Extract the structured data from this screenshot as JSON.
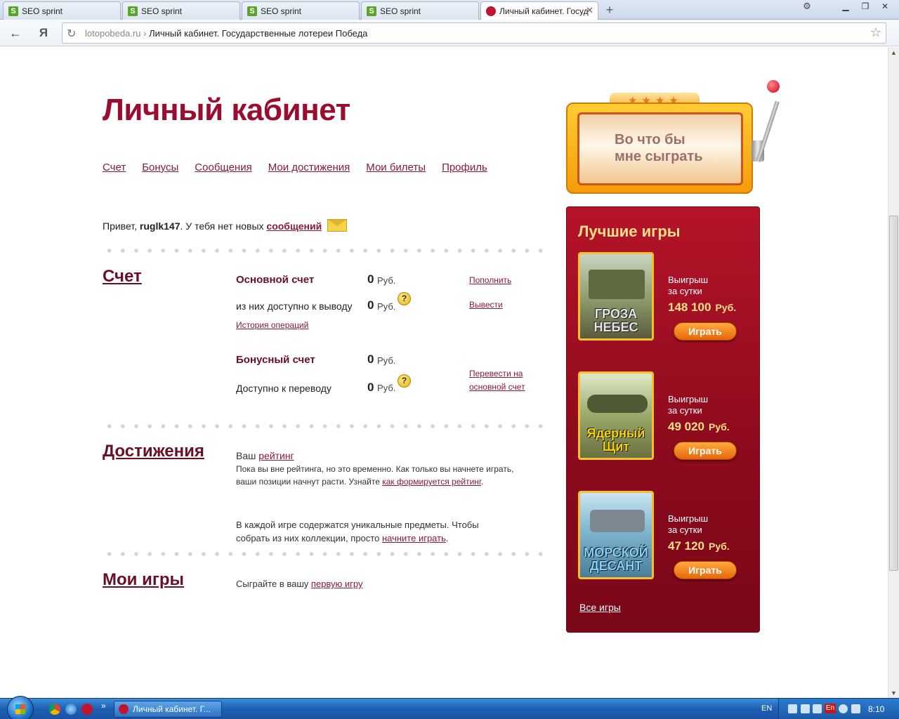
{
  "browser": {
    "tabs": [
      {
        "label": "SEO sprint",
        "active": false
      },
      {
        "label": "SEO sprint",
        "active": false
      },
      {
        "label": "SEO sprint",
        "active": false
      },
      {
        "label": "SEO sprint",
        "active": false
      },
      {
        "label": "Личный кабинет. Госуд",
        "active": true
      }
    ],
    "back_icon": "back-arrow-icon",
    "yandex_button": "Я",
    "address": {
      "domain": "lotopobeda.ru",
      "separator": "›",
      "page_title": "Личный кабинет. Государственные лотереи Победа"
    }
  },
  "page": {
    "title": "Личный кабинет",
    "nav": [
      "Счет",
      "Бонусы",
      "Сообщения",
      "Мои достижения",
      "Мои билеты",
      "Профиль"
    ],
    "greeting": {
      "prefix": "Привет,",
      "username": "ruglk147",
      "middle": ". У тебя нет новых",
      "link": "сообщений"
    },
    "account": {
      "title": "Счет",
      "main_label": "Основной счет",
      "main_value": "0",
      "currency": "Руб.",
      "topup_link": "Пополнить",
      "withdrawable_label": "из них доступно к выводу",
      "withdrawable_value": "0",
      "withdraw_link": "Вывести",
      "history_link": "История операций",
      "bonus_label": "Бонусный счет",
      "bonus_value": "0",
      "transferable_label": "Доступно к переводу",
      "transferable_value": "0",
      "transfer_link_1": "Перевести на",
      "transfer_link_2": "основной счет",
      "help_glyph": "?"
    },
    "achievements": {
      "title": "Достижения",
      "rating_prefix": "Ваш",
      "rating_link": "рейтинг",
      "text_1": "Пока вы вне рейтинга, но это временно. Как только вы начнете играть,",
      "text_2": "ваши позиции начнут расти. Узнайте",
      "rating_how_link": "как формируется рейтинг",
      "text_3": "В каждой игре содержатся уникальные предметы. Чтобы",
      "text_4": "собрать из них коллекции, просто",
      "start_link": "начните играть"
    },
    "my_games": {
      "title": "Мои игры",
      "prefix": "Сыграйте в вашу",
      "link": "первую игру"
    }
  },
  "banner": {
    "line1": "Во что бы",
    "line2": "мне сыграть",
    "stars": "★★★★"
  },
  "best_games": {
    "title": "Лучшие игры",
    "win_label_1": "Выигрыш",
    "win_label_2": "за сутки",
    "currency": "Руб.",
    "play_label": "Играть",
    "all_games": "Все игры",
    "games": [
      {
        "name_1": "ГРОЗА",
        "name_2": "НЕБЕС",
        "amount": "148 100"
      },
      {
        "name_1": "Ядерный",
        "name_2": "Щит",
        "amount": "49 020"
      },
      {
        "name_1": "МОРСКОЙ",
        "name_2": "ДЕСАНТ",
        "amount": "47 120"
      }
    ]
  },
  "taskbar": {
    "task_label": "Личный кабинет. Г...",
    "lang": "EN",
    "tray_lang": "En",
    "clock": "8:10",
    "more": "»"
  },
  "colors": {
    "brand": "#9b0d2e",
    "link": "#8b1a33",
    "panel": "#8b0a1d",
    "gold": "#ffe08a"
  }
}
